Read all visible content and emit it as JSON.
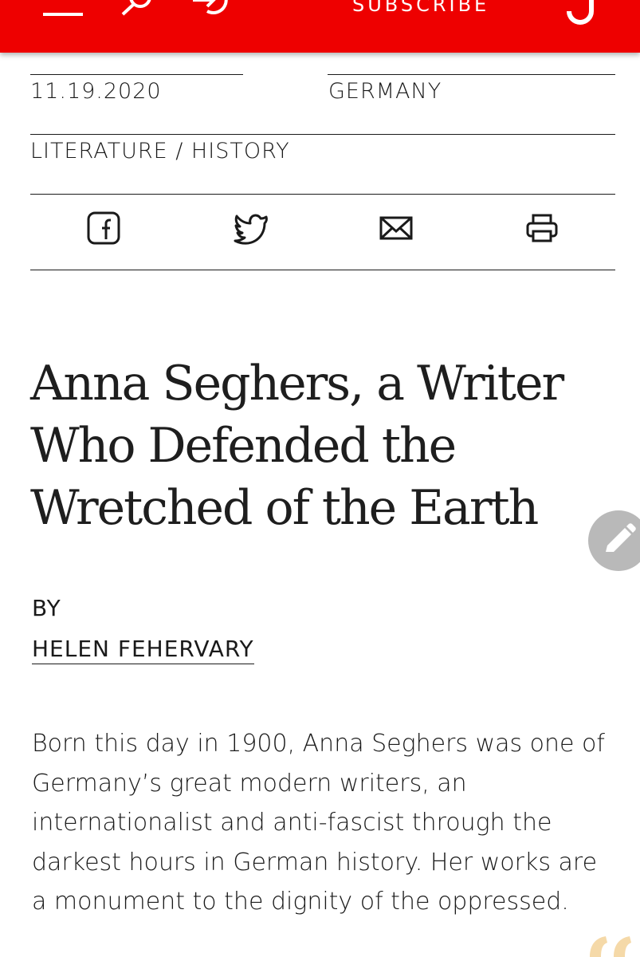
{
  "header": {
    "subscribe_label": "SUBSCRIBE",
    "logo_letter": "J",
    "background_color": "#ee0000"
  },
  "meta": {
    "date": "11.19.2020",
    "location": "GERMANY",
    "categories": "LITERATURE / HISTORY"
  },
  "share": {
    "icons": [
      "facebook-icon",
      "twitter-icon",
      "mail-icon",
      "print-icon"
    ]
  },
  "article": {
    "title": "Anna Seghers, a Writer Who Defended the Wretched of the Earth",
    "by_label": "BY",
    "author": "HELEN FEHERVARY",
    "dek": "Born this day in 1900, Anna Seghers was one of Germany’s great modern writers, an internationalist and anti-fascist through the darkest hours in German history. Her works are a monument to the dignity of the oppressed."
  },
  "fab": {
    "icon": "pencil-icon",
    "color": "#b9b9b9"
  }
}
